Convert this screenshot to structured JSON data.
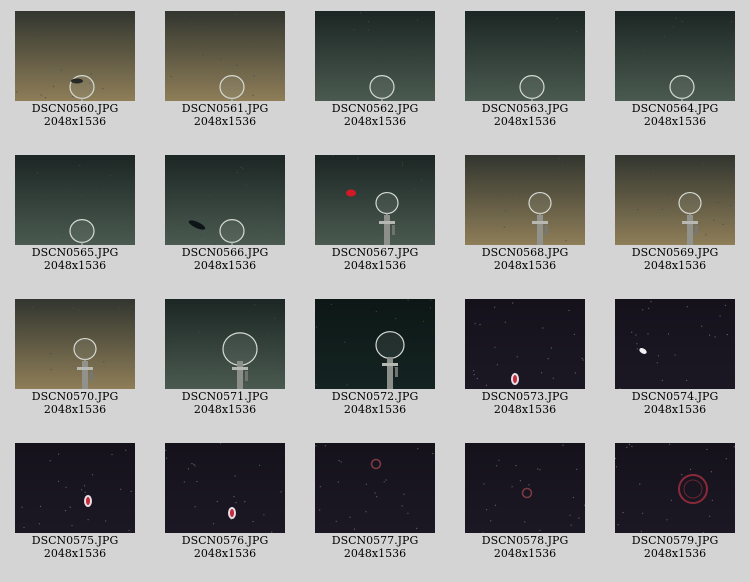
{
  "gallery": {
    "items": [
      {
        "filename": "DSCN0560.JPG",
        "dimensions": "2048x1536",
        "scene": "seafloor-sand",
        "objects": [
          "ring-frame",
          "fish"
        ]
      },
      {
        "filename": "DSCN0561.JPG",
        "dimensions": "2048x1536",
        "scene": "seafloor-sand",
        "objects": [
          "ring-frame"
        ]
      },
      {
        "filename": "DSCN0562.JPG",
        "dimensions": "2048x1536",
        "scene": "seafloor-green",
        "objects": [
          "ring-frame"
        ]
      },
      {
        "filename": "DSCN0563.JPG",
        "dimensions": "2048x1536",
        "scene": "seafloor-green",
        "objects": [
          "ring-frame"
        ]
      },
      {
        "filename": "DSCN0564.JPG",
        "dimensions": "2048x1536",
        "scene": "seafloor-green",
        "objects": [
          "ring-frame"
        ]
      },
      {
        "filename": "DSCN0565.JPG",
        "dimensions": "2048x1536",
        "scene": "seafloor-green",
        "objects": [
          "ring-frame"
        ]
      },
      {
        "filename": "DSCN0566.JPG",
        "dimensions": "2048x1536",
        "scene": "seafloor-green",
        "objects": [
          "ring-frame",
          "fish"
        ]
      },
      {
        "filename": "DSCN0567.JPG",
        "dimensions": "2048x1536",
        "scene": "seafloor-green",
        "objects": [
          "ring-frame",
          "red-organism",
          "mechanism"
        ]
      },
      {
        "filename": "DSCN0568.JPG",
        "dimensions": "2048x1536",
        "scene": "seafloor-sand",
        "objects": [
          "ring-frame",
          "mechanism"
        ]
      },
      {
        "filename": "DSCN0569.JPG",
        "dimensions": "2048x1536",
        "scene": "seafloor-sand",
        "objects": [
          "ring-frame",
          "mechanism"
        ]
      },
      {
        "filename": "DSCN0570.JPG",
        "dimensions": "2048x1536",
        "scene": "seafloor-sand",
        "objects": [
          "ring-frame",
          "mechanism"
        ]
      },
      {
        "filename": "DSCN0571.JPG",
        "dimensions": "2048x1536",
        "scene": "seafloor-green",
        "objects": [
          "ring-frame",
          "mechanism"
        ]
      },
      {
        "filename": "DSCN0572.JPG",
        "dimensions": "2048x1536",
        "scene": "dark-water",
        "objects": [
          "ring-frame",
          "mechanism"
        ]
      },
      {
        "filename": "DSCN0573.JPG",
        "dimensions": "2048x1536",
        "scene": "midwater-dark",
        "objects": [
          "jellyfish"
        ]
      },
      {
        "filename": "DSCN0574.JPG",
        "dimensions": "2048x1536",
        "scene": "midwater-dark",
        "objects": [
          "jellyfish-white"
        ]
      },
      {
        "filename": "DSCN0575.JPG",
        "dimensions": "2048x1536",
        "scene": "midwater-dark",
        "objects": [
          "jellyfish"
        ]
      },
      {
        "filename": "DSCN0576.JPG",
        "dimensions": "2048x1536",
        "scene": "midwater-dark",
        "objects": [
          "jellyfish"
        ]
      },
      {
        "filename": "DSCN0577.JPG",
        "dimensions": "2048x1536",
        "scene": "midwater-dark",
        "objects": [
          "jellyfish-ring-small"
        ]
      },
      {
        "filename": "DSCN0578.JPG",
        "dimensions": "2048x1536",
        "scene": "midwater-dark",
        "objects": [
          "jellyfish-ring-small"
        ]
      },
      {
        "filename": "DSCN0579.JPG",
        "dimensions": "2048x1536",
        "scene": "midwater-dark",
        "objects": [
          "jellyfish-ring-large"
        ]
      }
    ]
  }
}
